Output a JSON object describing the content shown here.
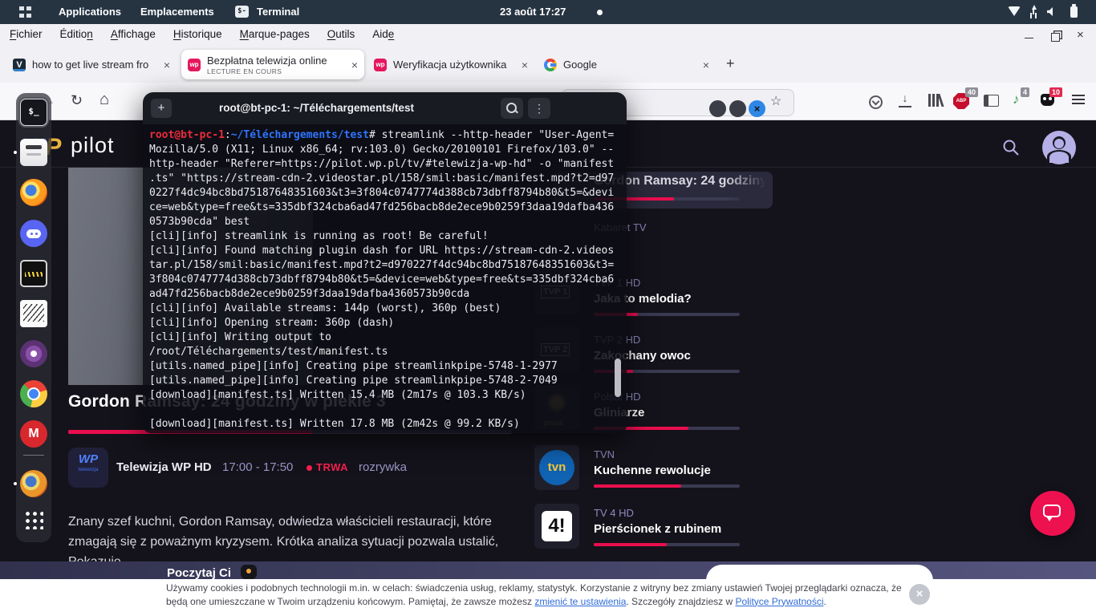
{
  "desktop": {
    "topbar": {
      "applications": "Applications",
      "places": "Emplacements",
      "terminal_chip": "$-",
      "terminal": "Terminal",
      "clock": "23 août 17:27"
    }
  },
  "browser": {
    "menus": [
      {
        "pre": "",
        "u": "F",
        "post": "ichier"
      },
      {
        "pre": "Éditio",
        "u": "n",
        "post": ""
      },
      {
        "pre": "",
        "u": "A",
        "post": "ffichage"
      },
      {
        "pre": "",
        "u": "H",
        "post": "istorique"
      },
      {
        "pre": "",
        "u": "M",
        "post": "arque-pages"
      },
      {
        "pre": "",
        "u": "O",
        "post": "utils"
      },
      {
        "pre": "Aid",
        "u": "e",
        "post": ""
      }
    ],
    "tabs": [
      {
        "icon": "v",
        "title": "how to get live stream fro",
        "sub": null,
        "active": false
      },
      {
        "icon": "wp",
        "title": "Bezpłatna telewizja online",
        "sub": "LECTURE EN COURS",
        "active": true
      },
      {
        "icon": "wp",
        "title": "Weryfikacja użytkownika",
        "sub": null,
        "active": false
      },
      {
        "icon": "google",
        "title": "Google",
        "sub": null,
        "active": false
      }
    ],
    "close_glyph": "×",
    "new_tab_glyph": "+",
    "toolbar": {
      "back_glyph": "←",
      "forward_glyph": "→",
      "reload_glyph": "↻",
      "home_glyph": "⌂",
      "star_glyph": "☆",
      "note_glyph": "♪",
      "abp_label": "ABP",
      "abp_badge": "40",
      "note_badge": "4",
      "ext_badge": "10"
    }
  },
  "terminal": {
    "title": "root@bt-pc-1: ~/Téléchargements/test",
    "lines": [
      [
        [
          "r",
          "root@bt-pc-1"
        ],
        [
          "w",
          ":"
        ],
        [
          "b",
          "~/Téléchargements/test"
        ],
        [
          "w",
          "# streamlink --http-header \"User-Agent="
        ]
      ],
      [
        [
          "w",
          "Mozilla/5.0 (X11; Linux x86_64; rv:103.0) Gecko/20100101 Firefox/103.0\" --"
        ]
      ],
      [
        [
          "w",
          "http-header \"Referer=https://pilot.wp.pl/tv/#telewizja-wp-hd\" -o \"manifest"
        ]
      ],
      [
        [
          "w",
          ".ts\" \"https://stream-cdn-2.videostar.pl/158/smil:basic/manifest.mpd?t2=d97"
        ]
      ],
      [
        [
          "w",
          "0227f4dc94bc8bd75187648351603&t3=3f804c0747774d388cb73dbff8794b80&t5=&devi"
        ]
      ],
      [
        [
          "w",
          "ce=web&type=free&ts=335dbf324cba6ad47fd256bacb8de2ece9b0259f3daa19dafba436"
        ]
      ],
      [
        [
          "w",
          "0573b90cda\" best"
        ]
      ],
      [
        [
          "w",
          "[cli][info] streamlink is running as root! Be careful!"
        ]
      ],
      [
        [
          "w",
          "[cli][info] Found matching plugin dash for URL https://stream-cdn-2.videos"
        ]
      ],
      [
        [
          "w",
          "tar.pl/158/smil:basic/manifest.mpd?t2=d970227f4dc94bc8bd75187648351603&t3="
        ]
      ],
      [
        [
          "w",
          "3f804c0747774d388cb73dbff8794b80&t5=&device=web&type=free&ts=335dbf324cba6"
        ]
      ],
      [
        [
          "w",
          "ad47fd256bacb8de2ece9b0259f3daa19dafba4360573b90cda"
        ]
      ],
      [
        [
          "w",
          "[cli][info] Available streams: 144p (worst), 360p (best)"
        ]
      ],
      [
        [
          "w",
          "[cli][info] Opening stream: 360p (dash)"
        ]
      ],
      [
        [
          "w",
          "[cli][info] Writing output to"
        ]
      ],
      [
        [
          "w",
          "/root/Téléchargements/test/manifest.ts"
        ]
      ],
      [
        [
          "w",
          "[utils.named_pipe][info] Creating pipe streamlinkpipe-5748-1-2977"
        ]
      ],
      [
        [
          "w",
          "[utils.named_pipe][info] Creating pipe streamlinkpipe-5748-2-7049"
        ]
      ],
      [
        [
          "w",
          "[download][manifest.ts] Written 15.4 MB (2m17s @ 103.3 KB/s)"
        ]
      ],
      [],
      [
        [
          "w",
          "[download][manifest.ts] Written 17.8 MB (2m42s @ 99.2 KB/s)"
        ]
      ]
    ]
  },
  "pilot": {
    "brand": "pilot",
    "logo_w": "W",
    "logo_p": "P",
    "selected_program": {
      "title": "Gordon Ramsay: 24 godziny w piekle 3",
      "channel": "Telewizja WP HD",
      "logo_top": "WP",
      "logo_sub": "telewizja",
      "time": "17:00 - 17:50",
      "status": "TRWA",
      "genre": "rozrywka",
      "description": "Znany szef kuchni, Gordon Ramsay, odwiedza właścicieli restauracji, które zmagają się z poważnym kryzysem. Krótka analiza sytuacji pozwala ustalić, Pokazuje",
      "progress": 0.55
    },
    "channels": [
      {
        "name": "",
        "title": "Gordon Ramsay: 24 godziny",
        "bar": 0.55,
        "selected": true,
        "logo": null,
        "logo_text": null
      },
      {
        "name": "Kabaret TV",
        "title": "",
        "bar": null,
        "selected": false,
        "logo": null,
        "logo_text": null
      },
      {
        "name": "TVP 1 HD",
        "title": "Jaka to melodia?",
        "bar": 0.3,
        "selected": false,
        "logo": "tvp1",
        "logo_text": "TVP 1"
      },
      {
        "name": "TVP 2 HD",
        "title": "Zakochany owoc",
        "bar": 0.27,
        "selected": false,
        "logo": "tvp2",
        "logo_text": "TVP 2"
      },
      {
        "name": "Polsat HD",
        "title": "Gliniarze",
        "bar": 0.65,
        "selected": false,
        "logo": "polsat",
        "logo_text": "polsat"
      },
      {
        "name": "TVN",
        "title": "Kuchenne rewolucje",
        "bar": 0.6,
        "selected": false,
        "logo": "tvn",
        "logo_text": "tvn"
      },
      {
        "name": "TV 4 HD",
        "title": "Pierścionek z rubinem",
        "bar": 0.5,
        "selected": false,
        "logo": "tv4",
        "logo_text": "4!"
      }
    ]
  },
  "bottom_bar": {
    "text": "Poczytaj Ci"
  },
  "cookie": {
    "text1": "Używamy cookies i podobnych technologii m.in. w celach: świadczenia usług, reklamy, statystyk. Korzystanie z witryny bez zmiany ustawień Twojej przeglądarki oznacza, że będą one umieszczane w Twoim urządzeniu końcowym. Pamiętaj, że zawsze możesz ",
    "link1": "zmienić te ustawienia",
    "text2": ". Szczegóły znajdziesz w ",
    "link2": "Polityce Prywatności",
    "text3": ".",
    "close_glyph": "×"
  },
  "dock": {
    "items": [
      {
        "icon": "terminal-icon",
        "glyph": "$_",
        "focused": true
      },
      {
        "icon": "files-icon",
        "dot": true
      },
      {
        "icon": "firefox-icon"
      },
      {
        "icon": "discord-icon"
      },
      {
        "icon": "oscilloscope-icon"
      },
      {
        "icon": "antenna-icon"
      },
      {
        "icon": "tor-browser-icon"
      },
      {
        "icon": "chrome-icon"
      },
      {
        "icon": "mega-icon",
        "glyph": "M"
      },
      {
        "icon": "divider"
      },
      {
        "icon": "firefox-icon-2",
        "dot": true
      },
      {
        "icon": "app-grid-icon"
      }
    ]
  }
}
